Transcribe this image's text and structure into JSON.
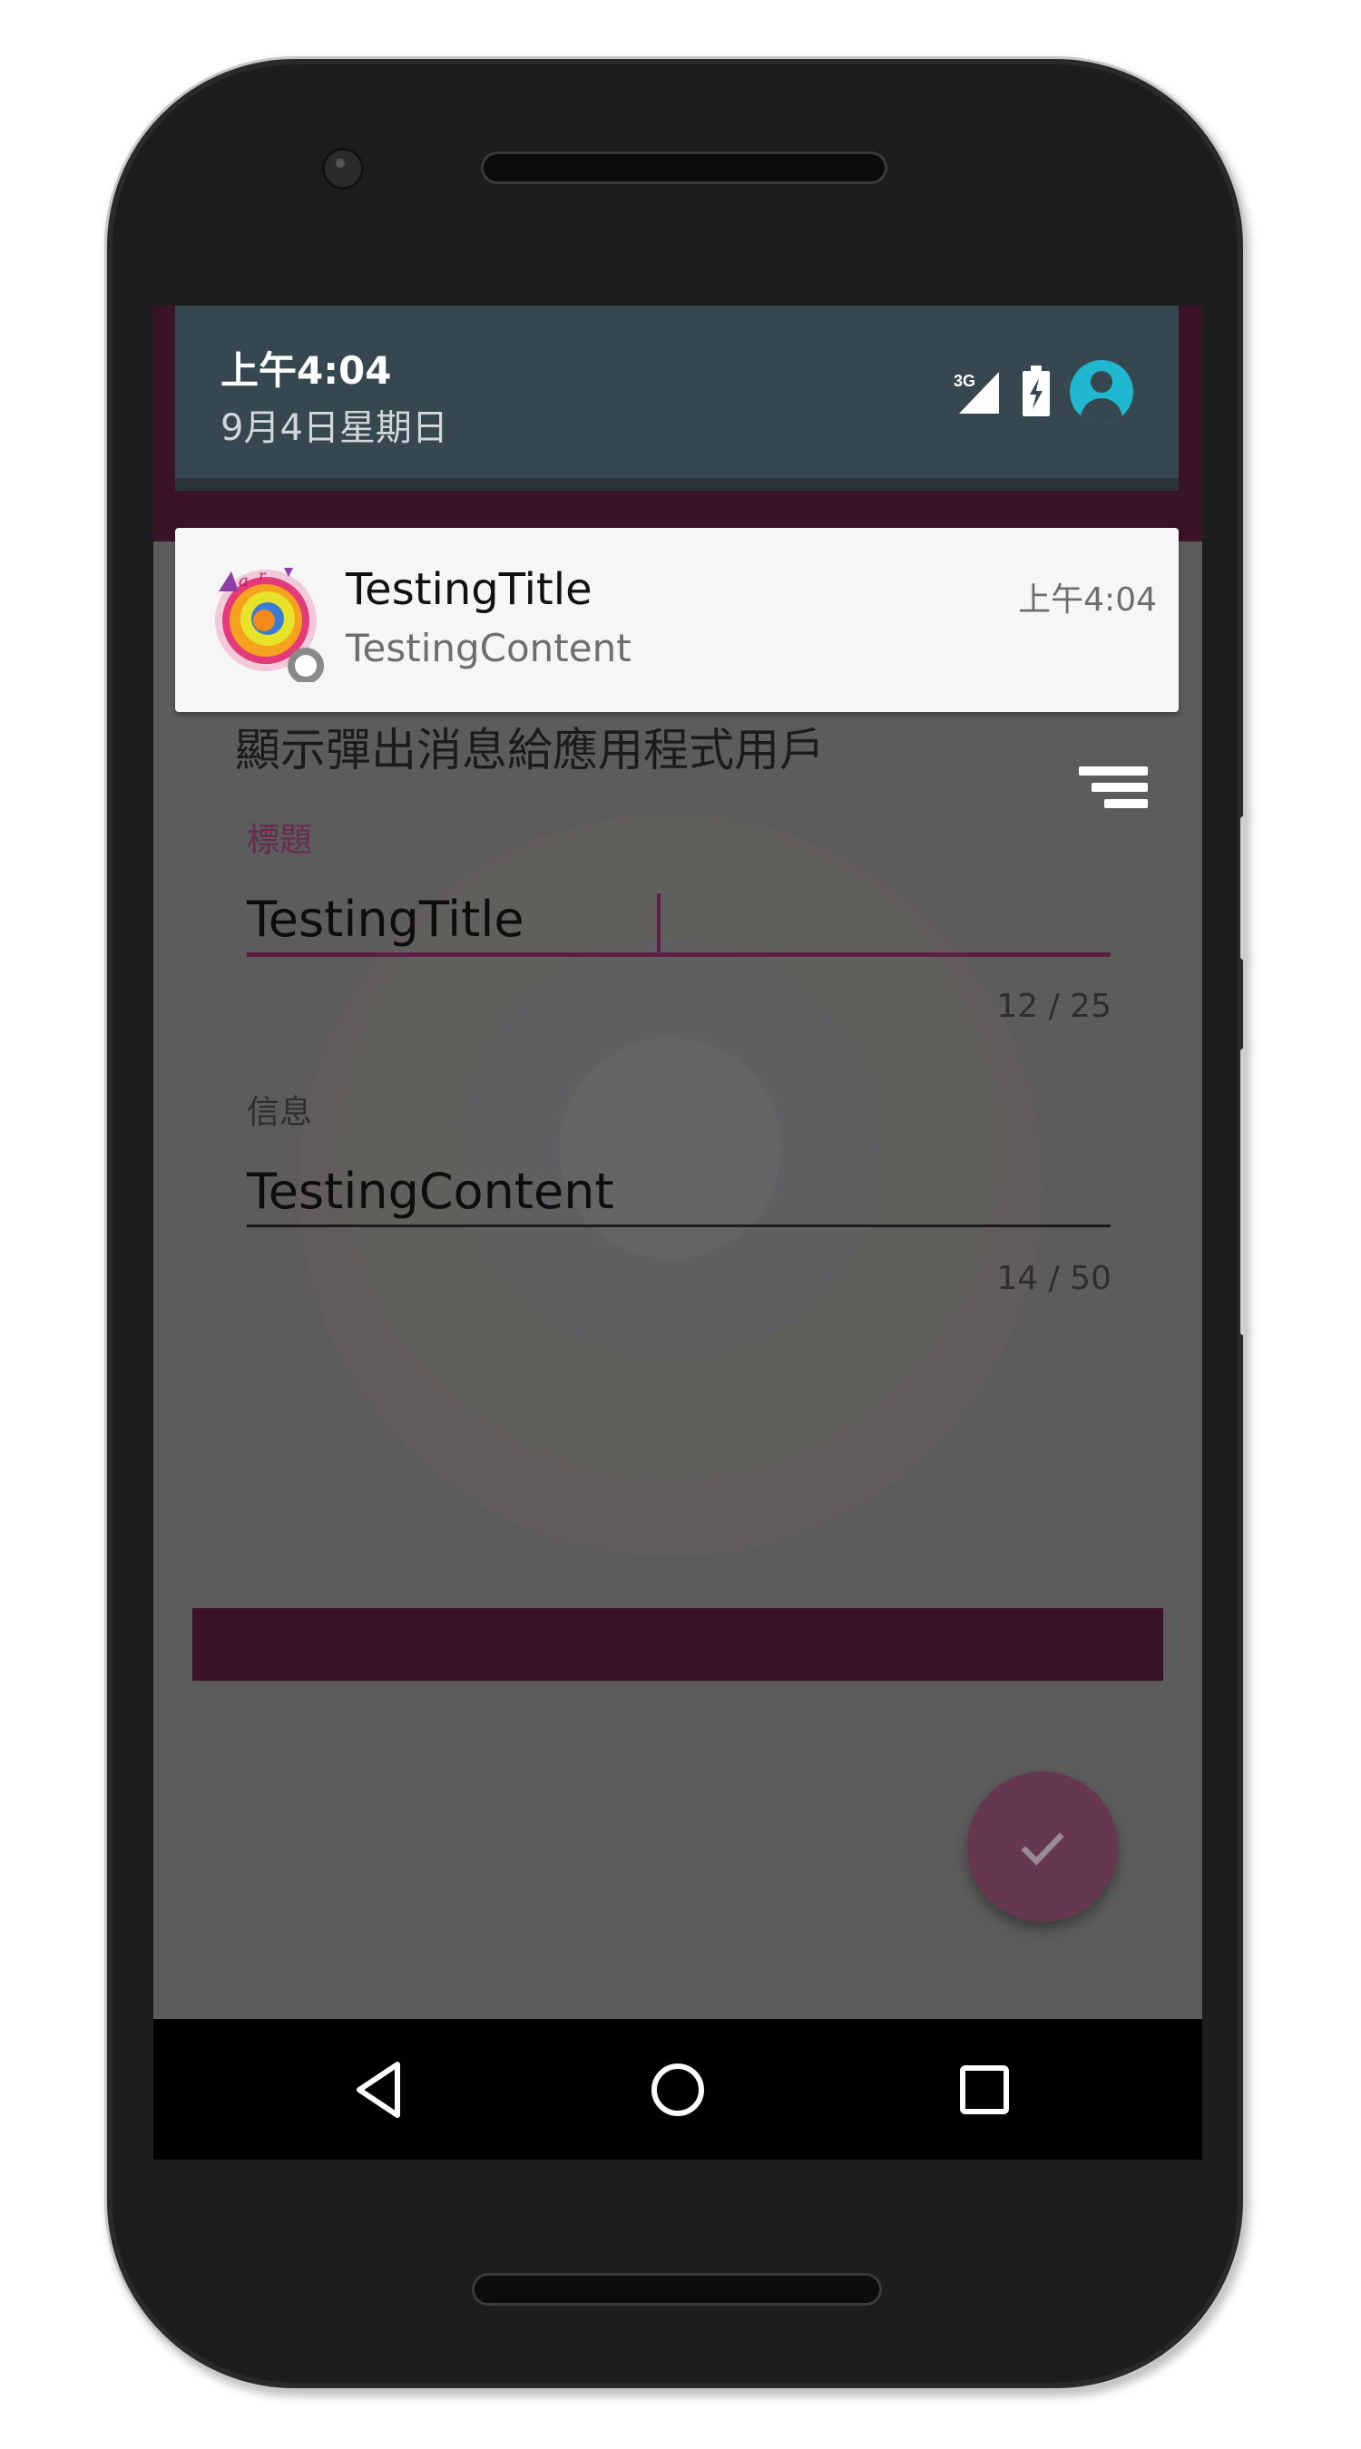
{
  "status_shade": {
    "time": "上午4:04",
    "date": "9月4日星期日",
    "network_label": "3G",
    "icons": [
      "signal-3g-icon",
      "battery-charging-icon",
      "account-icon"
    ]
  },
  "notification": {
    "title": "TestingTitle",
    "content": "TestingContent",
    "time": "上午4:04",
    "icon": "app-logo-icon"
  },
  "app": {
    "heading": "顯示彈出消息給應用程式用戶",
    "menu_icon": "sort-icon",
    "title_field": {
      "label": "標題",
      "value": "TestingTitle",
      "counter": "12 / 25"
    },
    "message_field": {
      "label": "信息",
      "value": "TestingContent",
      "counter": "14 / 50"
    },
    "fab_icon": "check-icon",
    "colors": {
      "primary_dark": "#3a1328",
      "accent": "#66384f",
      "shade": "#37474f",
      "avatar": "#1fb8cf"
    }
  },
  "nav_bar": {
    "buttons": [
      "back-icon",
      "home-icon",
      "recents-icon"
    ]
  }
}
